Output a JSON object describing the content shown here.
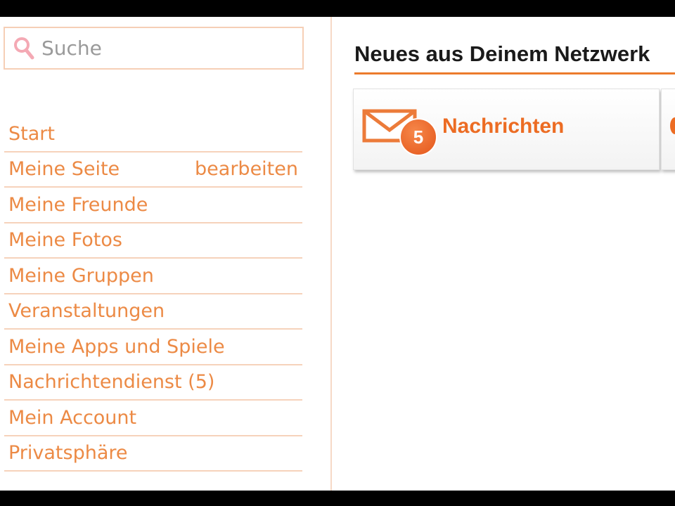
{
  "search": {
    "placeholder": "Suche",
    "icon": "search-icon"
  },
  "sidebar": {
    "items": [
      {
        "label": "Start"
      },
      {
        "label": "Meine Seite",
        "action": "bearbeiten"
      },
      {
        "label": "Meine Freunde"
      },
      {
        "label": "Meine Fotos"
      },
      {
        "label": "Meine Gruppen"
      },
      {
        "label": "Veranstaltungen"
      },
      {
        "label": "Meine Apps und Spiele"
      },
      {
        "label": "Nachrichtendienst (5)"
      },
      {
        "label": "Mein Account"
      },
      {
        "label": "Privatsphäre"
      }
    ]
  },
  "main": {
    "title": "Neues aus Deinem Netzwerk",
    "tiles": [
      {
        "label": "Nachrichten",
        "badge": "5",
        "icon": "envelope-icon"
      }
    ]
  },
  "colors": {
    "accent": "#ec6c23",
    "link": "#ec8a45",
    "divider": "#f6d2bb"
  }
}
